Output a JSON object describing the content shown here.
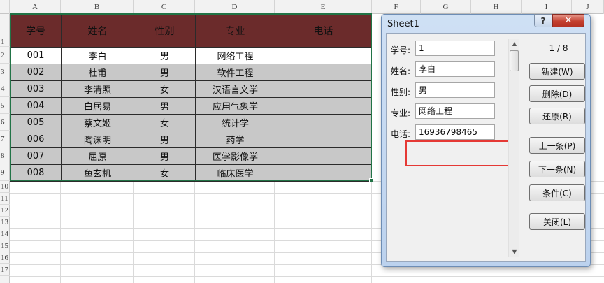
{
  "columns": [
    "A",
    "B",
    "C",
    "D",
    "E",
    "F",
    "G",
    "H",
    "I",
    "J"
  ],
  "rows": [
    "1",
    "2",
    "3",
    "4",
    "5",
    "6",
    "7",
    "8",
    "9",
    "10",
    "11",
    "12",
    "13",
    "14",
    "15",
    "16",
    "17"
  ],
  "table": {
    "headers": [
      "学号",
      "姓名",
      "性别",
      "专业",
      "电话"
    ],
    "rows": [
      [
        "001",
        "李白",
        "男",
        "网络工程",
        ""
      ],
      [
        "002",
        "杜甫",
        "男",
        "软件工程",
        ""
      ],
      [
        "003",
        "李清照",
        "女",
        "汉语言文学",
        ""
      ],
      [
        "004",
        "白居易",
        "男",
        "应用气象学",
        ""
      ],
      [
        "005",
        "蔡文姬",
        "女",
        "统计学",
        ""
      ],
      [
        "006",
        "陶渊明",
        "男",
        "药学",
        ""
      ],
      [
        "007",
        "屈原",
        "男",
        "医学影像学",
        ""
      ],
      [
        "008",
        "鱼玄机",
        "女",
        "临床医学",
        ""
      ]
    ]
  },
  "dialog": {
    "title": "Sheet1",
    "help_label": "?",
    "close_label": "✕",
    "record_count": "1 / 8",
    "fields": [
      {
        "label": "学号:",
        "value": "1"
      },
      {
        "label": "姓名:",
        "value": "李白"
      },
      {
        "label": "性别:",
        "value": "男"
      },
      {
        "label": "专业:",
        "value": "网络工程"
      },
      {
        "label": "电话:",
        "value": "16936798465"
      }
    ],
    "buttons": [
      "新建(W)",
      "删除(D)",
      "还原(R)",
      "上一条(P)",
      "下一条(N)",
      "条件(C)",
      "关闭(L)"
    ]
  },
  "colors": {
    "header_fill": "#6b2b2b",
    "body_fill": "#c8c8c8",
    "selection_border": "#217346",
    "highlight_border": "#e53935"
  }
}
